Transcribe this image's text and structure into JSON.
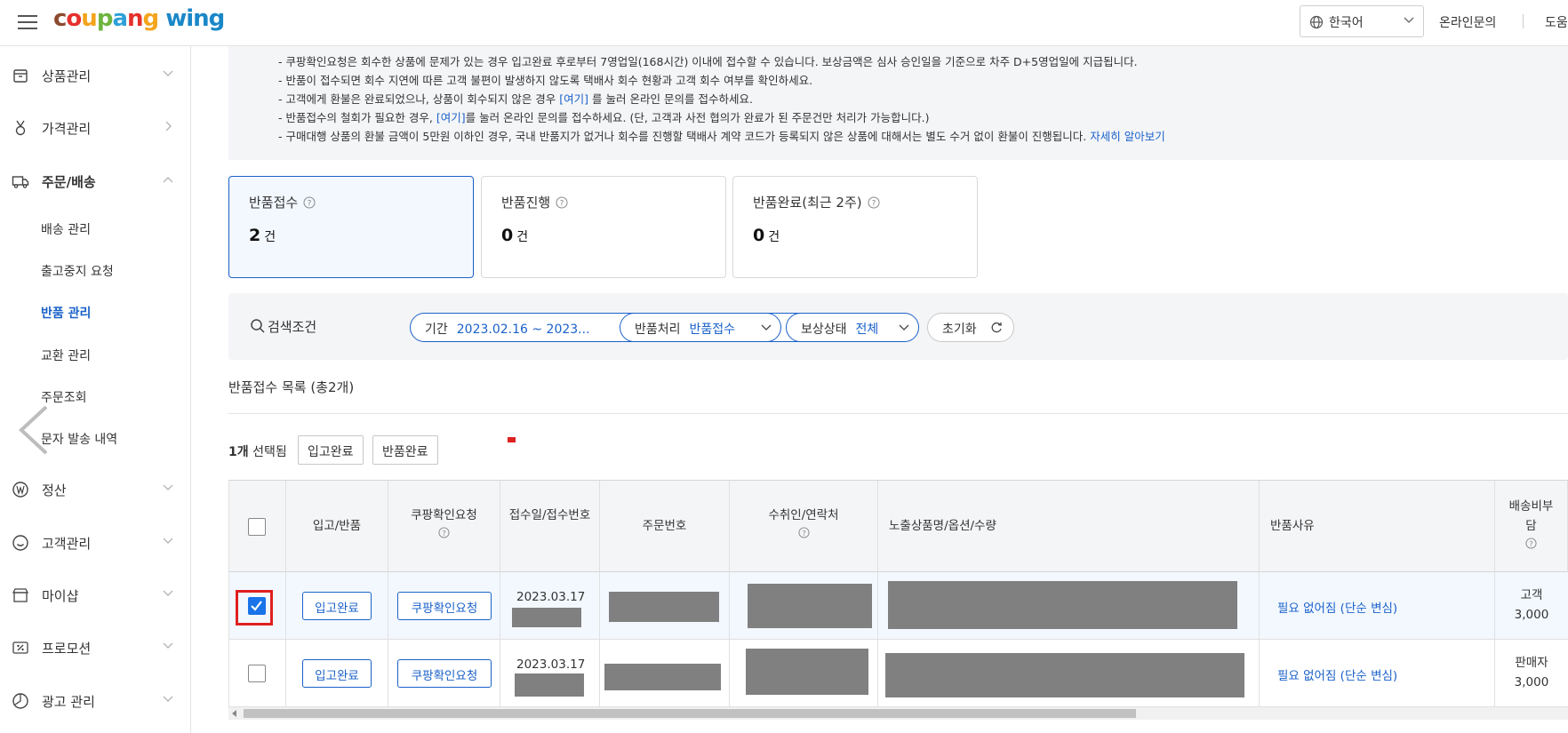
{
  "header": {
    "logo_parts": [
      "c",
      "o",
      "u",
      "p",
      "a",
      "n",
      "g"
    ],
    "logo_suffix": "wing",
    "language": "한국어",
    "online_inquiry": "온라인문의",
    "help": "도움"
  },
  "sidebar": {
    "items": [
      {
        "label": "상품관리",
        "icon": "box-icon"
      },
      {
        "label": "가격관리",
        "icon": "medal-icon"
      },
      {
        "label": "주문/배송",
        "icon": "truck-icon"
      },
      {
        "label": "정산",
        "icon": "won-icon"
      },
      {
        "label": "고객관리",
        "icon": "smile-icon"
      },
      {
        "label": "마이샵",
        "icon": "store-icon"
      },
      {
        "label": "프로모션",
        "icon": "percent-icon"
      },
      {
        "label": "광고 관리",
        "icon": "chart-icon"
      }
    ],
    "sub_items": [
      "배송 관리",
      "출고중지 요청",
      "반품 관리",
      "교환 관리",
      "주문조회",
      "문자 발송 내역"
    ]
  },
  "notice": {
    "lines": [
      "- 쿠팡확인요청은 회수한 상품에 문제가 있는 경우 입고완료 후로부터 7영업일(168시간) 이내에 접수할 수 있습니다. 보상금액은 심사 승인일을 기준으로 차주 D+5영업일에 지급됩니다.",
      "- 반품이 접수되면 회수 지연에 따른 고객 불편이 발생하지 않도록 택배사 회수 현황과 고객 회수 여부를 확인하세요.",
      "- 고객에게 환불은 완료되었으나, 상품이 회수되지 않은 경우",
      "를 눌러 온라인 문의를 접수하세요.",
      "- 반품접수의 철회가 필요한 경우,",
      "를 눌러 온라인 문의를 접수하세요. (단, 고객과 사전 협의가 완료가 된 주문건만 처리가 가능합니다.)",
      "- 구매대행 상품의 환불 금액이 5만원 이하인 경우, 국내 반품지가 없거나 회수를 진행할 택배사 계약 코드가 등록되지 않은 상품에 대해서는 별도 수거 없이 환불이 진행됩니다."
    ],
    "here_link_1": "[여기]",
    "here_link_2": "[여기]",
    "learn_more": "자세히 알아보기"
  },
  "cards": [
    {
      "title": "반품접수",
      "count": "2",
      "unit": "건"
    },
    {
      "title": "반품진행",
      "count": "0",
      "unit": "건"
    },
    {
      "title": "반품완료(최근 2주)",
      "count": "0",
      "unit": "건"
    }
  ],
  "filters": {
    "search_label": "검색조건",
    "period_key": "기간",
    "period_value": "2023.02.16 ~ 2023...",
    "process_key": "반품처리",
    "process_value": "반품접수",
    "comp_key": "보상상태",
    "comp_value": "전체",
    "reset": "초기화"
  },
  "list": {
    "title": "반품접수 목록 (총2개)",
    "selected_count": "1개",
    "selected_suffix": " 선택됨",
    "btn_in_complete": "입고완료",
    "btn_return_complete": "반품완료"
  },
  "table": {
    "headers": {
      "inbound": "입고/반품",
      "coupang_req": "쿠팡확인요청",
      "recv": "접수일/접수번호",
      "order_no": "주문번호",
      "recipient": "수취인/연락처",
      "product": "노출상품명/옵션/수량",
      "reason": "반품사유",
      "ship": "배송비부담"
    },
    "rows": [
      {
        "checked": true,
        "inbound_btn": "입고완료",
        "req_btn": "쿠팡확인요청",
        "date": "2023.03.17",
        "reason": "필요 없어짐 (단순 변심)",
        "ship_payer": "고객",
        "ship_fee": "3,000"
      },
      {
        "checked": false,
        "inbound_btn": "입고완료",
        "req_btn": "쿠팡확인요청",
        "date": "2023.03.17",
        "reason": "필요 없어짐 (단순 변심)",
        "ship_payer": "판매자",
        "ship_fee": "3,000"
      }
    ]
  },
  "colors": {
    "accent": "#1a61c9",
    "mask": "#808080",
    "highlight": "#e02020"
  }
}
